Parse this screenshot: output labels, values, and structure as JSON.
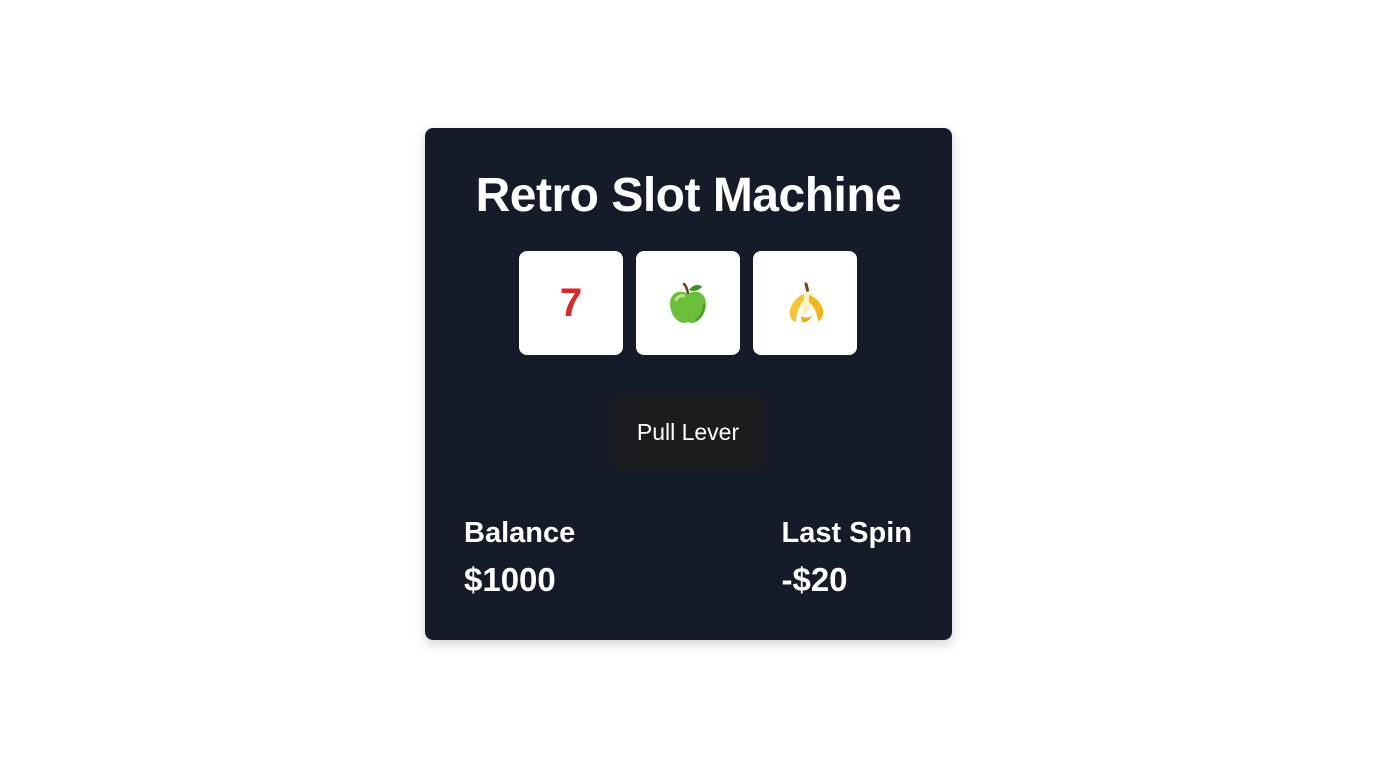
{
  "app": {
    "title": "Retro Slot Machine"
  },
  "reels": [
    {
      "symbol": "7",
      "icon": "seven-icon",
      "color": "#d12b2b"
    },
    {
      "symbol": "🍏",
      "icon": "green-apple-icon"
    },
    {
      "symbol": "🍌",
      "icon": "banana-icon"
    }
  ],
  "controls": {
    "lever_label": "Pull Lever"
  },
  "stats": {
    "balance_label": "Balance",
    "balance_value": "$1000",
    "last_spin_label": "Last Spin",
    "last_spin_value": "-$20"
  },
  "colors": {
    "panel": "#151b28",
    "button": "#1b1c20",
    "reel_face": "#ffffff",
    "accent_red": "#d12b2b"
  }
}
